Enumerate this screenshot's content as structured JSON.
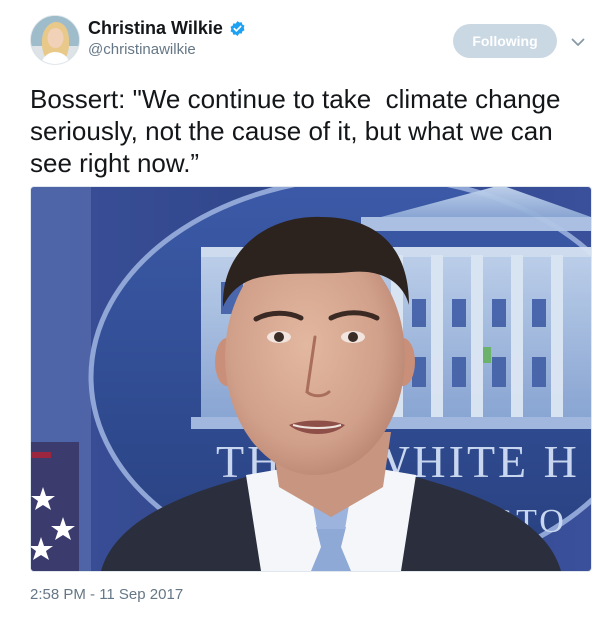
{
  "tweet": {
    "display_name": "Christina Wilkie",
    "handle": "@christinawilkie",
    "verified_icon": "verified-badge-icon",
    "follow_button_label": "Following",
    "caret_icon": "chevron-down-icon",
    "text": "Bossert: \"We continue to take  climate change seriously, not the cause of it, but what we can see right now.”",
    "media": {
      "type": "photo",
      "backdrop_lettering": "THE WHITE HOUSE WASHINGTON"
    },
    "timestamp": "2:58 PM - 11 Sep 2017"
  },
  "colors": {
    "follow_button_bg": "#c9d8e3",
    "verified_blue": "#1da1f2",
    "secondary_text": "#657786",
    "primary_text": "#14171a"
  }
}
